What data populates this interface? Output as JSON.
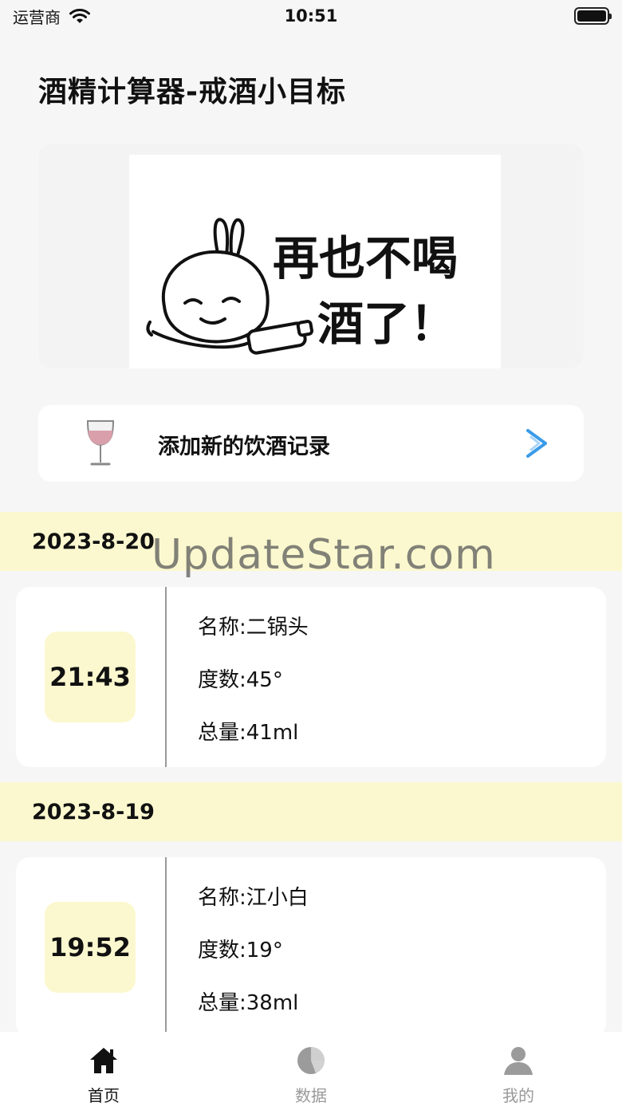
{
  "status_bar": {
    "carrier": "运营商",
    "time": "10:51"
  },
  "app_title": "酒精计算器-戒酒小目标",
  "banner": {
    "caption_line1": "再也不喝",
    "caption_line2": "酒了！"
  },
  "add_record": {
    "label": "添加新的饮酒记录"
  },
  "records": [
    {
      "date": "2023-8-20",
      "time": "21:43",
      "name": "名称:二锅头",
      "degree": "度数:45°",
      "volume": "总量:41ml"
    },
    {
      "date": "2023-8-19",
      "time": "19:52",
      "name": "名称:江小白",
      "degree": "度数:19°",
      "volume": "总量:38ml"
    }
  ],
  "watermark": "UpdateStar.com",
  "tab_bar": {
    "tabs": [
      {
        "label": "首页",
        "icon": "home-icon",
        "active": true
      },
      {
        "label": "数据",
        "icon": "pie-chart-icon",
        "active": false
      },
      {
        "label": "我的",
        "icon": "person-icon",
        "active": false
      }
    ]
  },
  "colors": {
    "date_highlight": "#fbf8cf",
    "chevron": "#3a9be8",
    "wine": "#d9a0ab"
  }
}
